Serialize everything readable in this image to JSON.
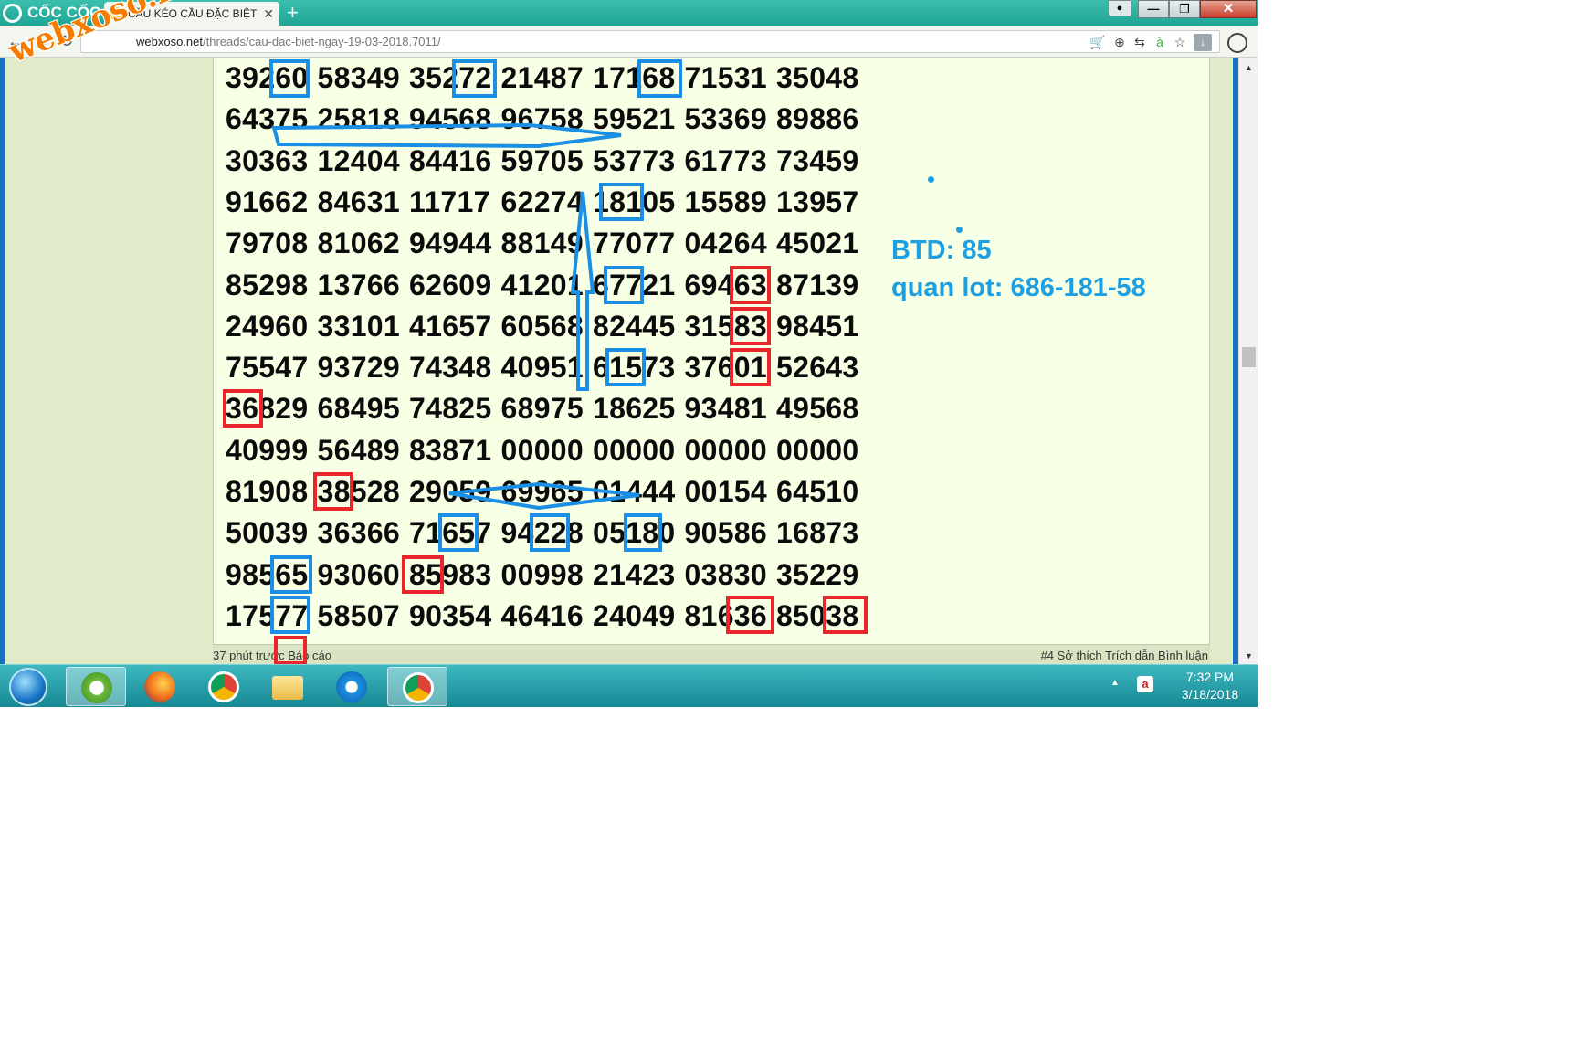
{
  "browser": {
    "brand": "CỐC CỐC",
    "tab_title": "CẦU KÉO CẦU ĐẶC BIỆT",
    "tab_favicon": "XS",
    "tab_close": "✕",
    "new_tab": "+",
    "url_host": "webxoso.net",
    "url_path": "/threads/cau-dac-biet-ngay-19-03-2018.7011/"
  },
  "watermark": "webxoso.net",
  "numbers": [
    [
      "39260",
      "58349",
      "35272",
      "21487",
      "17168",
      "71531",
      "35048"
    ],
    [
      "64375",
      "25818",
      "94568",
      "96758",
      "59521",
      "53369",
      "89886"
    ],
    [
      "30363",
      "12404",
      "84416",
      "59705",
      "53773",
      "61773",
      "73459"
    ],
    [
      "91662",
      "84631",
      "11717",
      "62274",
      "18105",
      "15589",
      "13957"
    ],
    [
      "79708",
      "81062",
      "94944",
      "88149",
      "77077",
      "04264",
      "45021"
    ],
    [
      "85298",
      "13766",
      "62609",
      "41201",
      "67721",
      "69463",
      "87139"
    ],
    [
      "24960",
      "33101",
      "41657",
      "60568",
      "82445",
      "31583",
      "98451"
    ],
    [
      "75547",
      "93729",
      "74348",
      "40951",
      "61573",
      "37601",
      "52643"
    ],
    [
      "36829",
      "68495",
      "74825",
      "68975",
      "18625",
      "93481",
      "49568"
    ],
    [
      "40999",
      "56489",
      "83871",
      "00000",
      "00000",
      "00000",
      "00000"
    ],
    [
      "81908",
      "38528",
      "29059",
      "69965",
      "01444",
      "00154",
      "64510"
    ],
    [
      "50039",
      "36366",
      "71657",
      "94228",
      "05180",
      "90586",
      "16873"
    ],
    [
      "98565",
      "93060",
      "85983",
      "00998",
      "21423",
      "03830",
      "35229"
    ],
    [
      "17577",
      "58507",
      "90354",
      "46416",
      "24049",
      "81636",
      "85038"
    ]
  ],
  "annotation": {
    "btd": "BTD: 85",
    "quan_lot": "quan lot: 686-181-58"
  },
  "post_footer": {
    "left": "37 phút trước  Báo cáo",
    "right": "#4  Sở thích  Trích dẫn  Bình luận"
  },
  "highlight_colors": {
    "blue": "#1a8fe3",
    "red": "#e8262b"
  },
  "taskbar": {
    "time": "7:32 PM",
    "date": "3/18/2018"
  }
}
